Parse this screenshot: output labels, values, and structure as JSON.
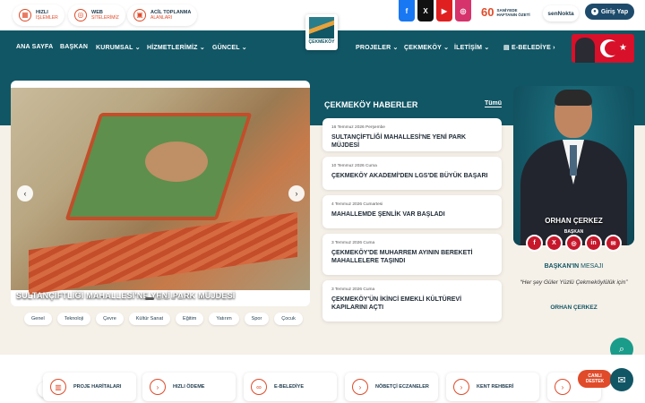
{
  "quick_links": [
    {
      "line1": "HIZLI",
      "line2": "İŞLEMLER",
      "icon": "grid-icon"
    },
    {
      "line1": "WEB",
      "line2": "SİTELERİMİZ",
      "icon": "globe-icon"
    },
    {
      "line1": "ACİL TOPLANMA",
      "line2": "ALANLARI",
      "icon": "location-icon"
    }
  ],
  "social_top": [
    "f",
    "X",
    "▶",
    "◎"
  ],
  "promo": {
    "number": "60",
    "line1": "SANİYEDE",
    "line2": "HAFTANIN ÖZETİ"
  },
  "sen_nokta": "senNokta",
  "login_label": "Giriş Yap",
  "nav_left": [
    "ANA SAYFA",
    "BAŞKAN",
    "KURUMSAL",
    "HİZMETLERİMİZ",
    "GÜNCEL"
  ],
  "nav_right": [
    "PROJELER",
    "ÇEKMEKÖY",
    "İLETİŞİM",
    "E-BELEDİYE"
  ],
  "logo_text": "ÇEKMEKÖY",
  "slider": {
    "caption": "SULTANÇİFTLİĞİ MAHALLESİ'NE YENİ PARK MÜJDESİ",
    "prev": "‹",
    "next": "›"
  },
  "categories": [
    "Genel",
    "Teknoloji",
    "Çevre",
    "Kültür Sanat",
    "Eğitim",
    "Yatırım",
    "Spor",
    "Çocuk"
  ],
  "news": {
    "heading": "ÇEKMEKÖY HABERLER",
    "all_label": "Tümü",
    "items": [
      {
        "date": "16 Temmuz 2026 Perşembe",
        "title": "SULTANÇİFTLİĞİ MAHALLESİ'NE YENİ PARK MÜJDESİ"
      },
      {
        "date": "10 Temmuz 2026 Cuma",
        "title": "ÇEKMEKÖY AKADEMİ'DEN LGS'DE BÜYÜK BAŞARI"
      },
      {
        "date": "4 Temmuz 2026 Cumartesi",
        "title": "MAHALLEMDE ŞENLİK VAR BAŞLADI"
      },
      {
        "date": "3 Temmuz 2026 Cuma",
        "title": "ÇEKMEKÖY'DE MUHARREM AYININ BEREKETİ MAHALLELERE TAŞINDI"
      },
      {
        "date": "3 Temmuz 2026 Cuma",
        "title": "ÇEKMEKÖY'ÜN İKİNCİ EMEKLİ KÜLTÜREVİ KAPILARINI AÇTI"
      }
    ]
  },
  "mayor": {
    "name": "ORHAN ÇERKEZ",
    "role": "BAŞKAN",
    "social": [
      "f",
      "X",
      "◎",
      "in",
      "✉"
    ],
    "message_bold": "BAŞKAN'IN",
    "message_rest": " MESAJI",
    "quote": "“Her şey Güler Yüzlü Çekmeköylülük için”",
    "signature": "ORHAN ÇERKEZ"
  },
  "bottom_links": [
    {
      "label": "PROJE HARİTALARI",
      "icon": "building-icon"
    },
    {
      "label": "HIZLI ÖDEME",
      "icon": "arrow-right-icon"
    },
    {
      "label": "E-BELEDİYE",
      "icon": "link-icon"
    },
    {
      "label": "NÖBETÇİ ECZANELER",
      "icon": "arrow-right-icon"
    },
    {
      "label": "KENT REHBERİ",
      "icon": "arrow-right-icon"
    },
    {
      "label": "",
      "icon": "arrow-right-icon"
    }
  ],
  "live_support": {
    "line1": "CANLI",
    "line2": "DESTEK"
  },
  "colors": {
    "primary": "#115665",
    "accent": "#e04b2a",
    "facebook": "#1877f2",
    "x": "#111111",
    "youtube": "#e02020",
    "instagram": "#d6336c"
  }
}
